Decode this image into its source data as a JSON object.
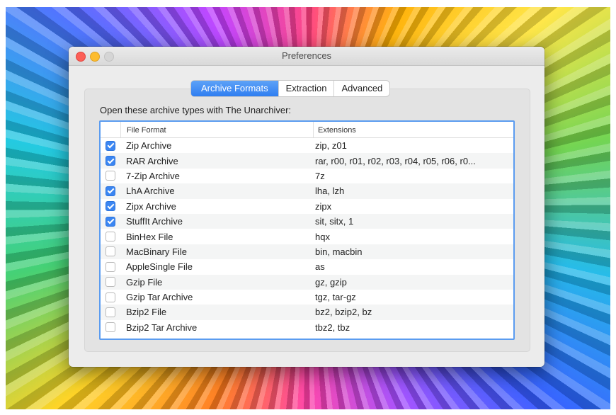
{
  "window": {
    "title": "Preferences"
  },
  "tabs": [
    {
      "label": "Archive Formats",
      "active": true
    },
    {
      "label": "Extraction",
      "active": false
    },
    {
      "label": "Advanced",
      "active": false
    }
  ],
  "section_label": "Open these archive types with The Unarchiver:",
  "table": {
    "columns": [
      "File Format",
      "Extensions"
    ],
    "rows": [
      {
        "checked": true,
        "format": "Zip Archive",
        "extensions": "zip, z01"
      },
      {
        "checked": true,
        "format": "RAR Archive",
        "extensions": "rar, r00, r01, r02, r03, r04, r05, r06, r0..."
      },
      {
        "checked": false,
        "format": "7-Zip Archive",
        "extensions": "7z"
      },
      {
        "checked": true,
        "format": "LhA Archive",
        "extensions": "lha, lzh"
      },
      {
        "checked": true,
        "format": "Zipx Archive",
        "extensions": "zipx"
      },
      {
        "checked": true,
        "format": "StuffIt Archive",
        "extensions": "sit, sitx, 1"
      },
      {
        "checked": false,
        "format": "BinHex File",
        "extensions": "hqx"
      },
      {
        "checked": false,
        "format": "MacBinary File",
        "extensions": "bin, macbin"
      },
      {
        "checked": false,
        "format": "AppleSingle File",
        "extensions": "as"
      },
      {
        "checked": false,
        "format": "Gzip File",
        "extensions": "gz, gzip"
      },
      {
        "checked": false,
        "format": "Gzip Tar Archive",
        "extensions": "tgz, tar-gz"
      },
      {
        "checked": false,
        "format": "Bzip2 File",
        "extensions": "bz2, bzip2, bz"
      },
      {
        "checked": false,
        "format": "Bzip2 Tar Archive",
        "extensions": "tbz2, tbz"
      }
    ]
  }
}
